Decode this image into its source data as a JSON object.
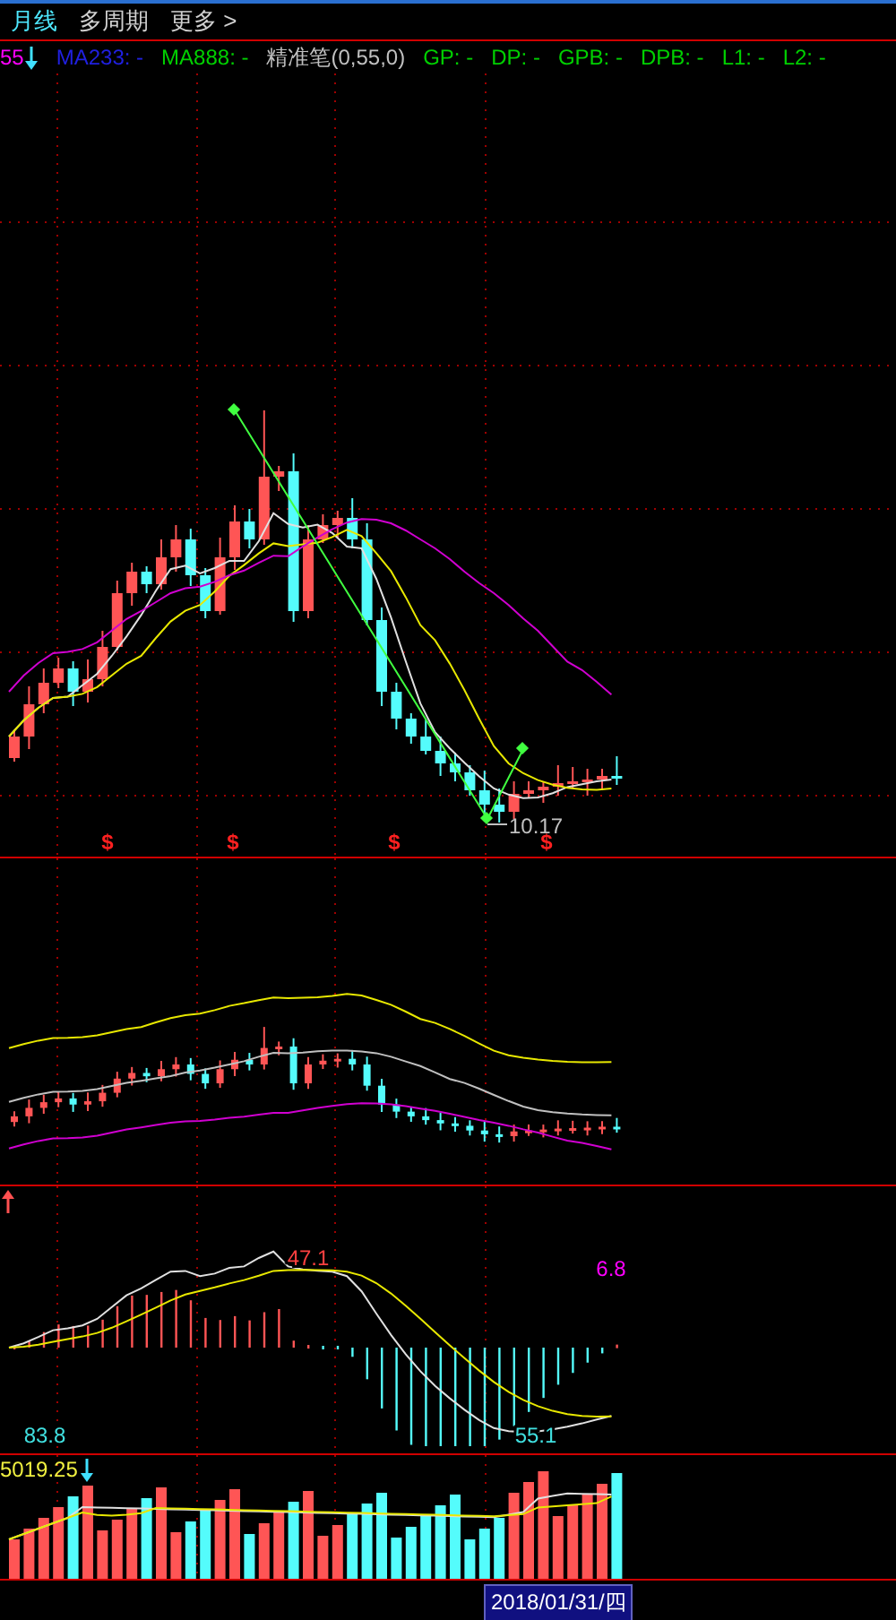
{
  "toolbar": {
    "tabs": [
      {
        "label": "月线",
        "selected": true
      },
      {
        "label": "多周期",
        "selected": false
      },
      {
        "label": "更多 >",
        "selected": false
      }
    ]
  },
  "legend": [
    {
      "text": "55",
      "color": "#ff00ff"
    },
    {
      "text": "MA233: -",
      "color": "#2020e0"
    },
    {
      "text": "MA888: -",
      "color": "#00d000"
    },
    {
      "text": "精准笔(0,55,0)",
      "color": "#c0c0c0"
    },
    {
      "text": "GP: -",
      "color": "#00d000"
    },
    {
      "text": "DP: -",
      "color": "#00d000"
    },
    {
      "text": "GPB: -",
      "color": "#00d000"
    },
    {
      "text": "DPB: -",
      "color": "#00d000"
    },
    {
      "text": "L1: -",
      "color": "#00d000"
    },
    {
      "text": "L2: -",
      "color": "#00d000"
    }
  ],
  "main_panel": {
    "low_label": "10.17",
    "signals": [
      "$",
      "$",
      "$",
      "$"
    ]
  },
  "indicator_panel": {
    "labels": [
      {
        "text": "47.1",
        "color": "#ff4040"
      },
      {
        "text": "6.8",
        "color": "#ff00ff"
      },
      {
        "text": "83.8",
        "color": "#40e0e0"
      },
      {
        "text": "55.1",
        "color": "#40e0e0"
      }
    ]
  },
  "volume_panel": {
    "value": "5019.25"
  },
  "axis": {
    "cursor_date": "2018/01/31/四"
  }
}
